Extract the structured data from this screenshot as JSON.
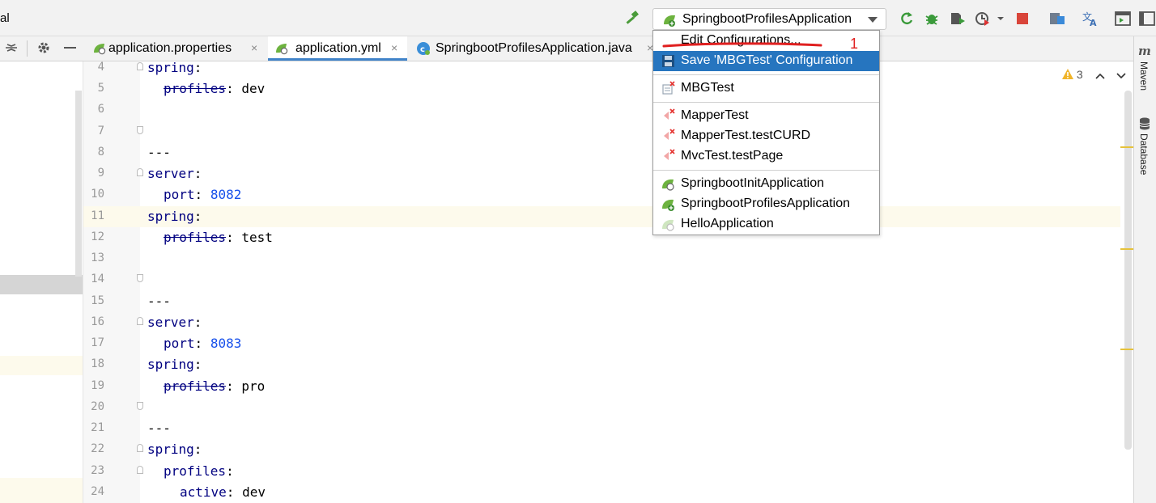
{
  "toolbar": {
    "title_fragment": "al",
    "run_config": "SpringbootProfilesApplication"
  },
  "tabs": [
    {
      "label": "application.properties"
    },
    {
      "label": "application.yml"
    },
    {
      "label": "SpringbootProfilesApplication.java"
    }
  ],
  "close_glyph": "×",
  "editor": {
    "lines": [
      {
        "n": "4"
      },
      {
        "n": "5"
      },
      {
        "n": "6"
      },
      {
        "n": "7"
      },
      {
        "n": "8"
      },
      {
        "n": "9"
      },
      {
        "n": "10"
      },
      {
        "n": "11"
      },
      {
        "n": "12"
      },
      {
        "n": "13"
      },
      {
        "n": "14"
      },
      {
        "n": "15"
      },
      {
        "n": "16"
      },
      {
        "n": "17"
      },
      {
        "n": "18"
      },
      {
        "n": "19"
      },
      {
        "n": "20"
      },
      {
        "n": "21"
      },
      {
        "n": "22"
      },
      {
        "n": "23"
      },
      {
        "n": "24"
      }
    ],
    "tokens": {
      "spring": "spring",
      "server": "server",
      "profiles": "profiles",
      "port": "port",
      "active": "active",
      "sep": "---",
      "colon": ":",
      "v_dev": "dev",
      "v_test": "test",
      "v_pro": "pro",
      "v_8082": "8082",
      "v_8083": "8083"
    }
  },
  "inspections": {
    "warnings": "3"
  },
  "side_tools": {
    "maven": "Maven",
    "database": "Database"
  },
  "dropdown": {
    "edit": "Edit Configurations...",
    "annotation": "1",
    "save": "Save 'MBGTest' Configuration",
    "items": [
      {
        "label": "MBGTest"
      },
      {
        "label": "MapperTest"
      },
      {
        "label": "MapperTest.testCURD"
      },
      {
        "label": "MvcTest.testPage"
      },
      {
        "label": "SpringbootInitApplication"
      },
      {
        "label": "SpringbootProfilesApplication"
      },
      {
        "label": "HelloApplication"
      }
    ]
  },
  "colors": {
    "accent": "#2675bf",
    "annotation": "#e02020",
    "keyword": "#000080",
    "number": "#1750eb"
  }
}
